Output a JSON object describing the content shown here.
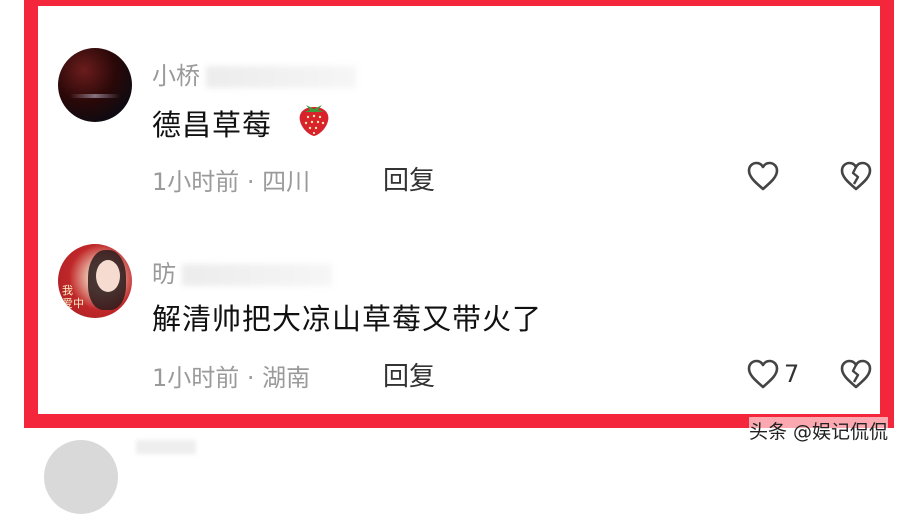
{
  "comments": [
    {
      "username": "小桥",
      "text": "德昌草莓",
      "emoji": "strawberry-emoji",
      "meta": "1小时前 · 四川",
      "reply_label": "回复",
      "likes": ""
    },
    {
      "username": "昉",
      "text": "解清帅把大凉山草莓又带火了",
      "meta": "1小时前 · 湖南",
      "reply_label": "回复",
      "likes": "7"
    }
  ],
  "avatar2_text": "我\n爱中",
  "watermark": "头条 @娱记侃侃",
  "colors": {
    "frame": "#f4263b",
    "meta": "#9a9a9a"
  },
  "icons": [
    "heart-outline-icon",
    "broken-heart-icon",
    "strawberry-icon"
  ]
}
